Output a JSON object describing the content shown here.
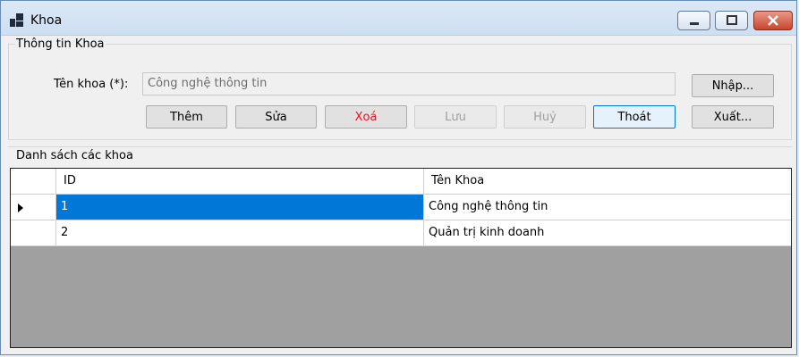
{
  "window": {
    "title": "Khoa",
    "minimize_icon": "minimize-icon",
    "maximize_icon": "maximize-icon",
    "close_icon": "close-icon"
  },
  "info_group": {
    "title": "Thông tin Khoa",
    "name_label": "Tên khoa (*):",
    "name_value": "Công nghệ thông tin"
  },
  "buttons": {
    "add": "Thêm",
    "edit": "Sửa",
    "delete": "Xoá",
    "save": "Lưu",
    "cancel": "Huỷ",
    "exit": "Thoát",
    "import": "Nhập...",
    "export": "Xuất..."
  },
  "list_group": {
    "title": "Danh sách các khoa",
    "columns": [
      "ID",
      "Tên Khoa"
    ],
    "rows": [
      {
        "id": "1",
        "name": "Công nghệ thông tin"
      },
      {
        "id": "2",
        "name": "Quản trị kinh doanh"
      }
    ]
  },
  "colors": {
    "selection": "#0078d7",
    "delete_text": "#e81123",
    "grid_background": "#a0a0a0"
  }
}
